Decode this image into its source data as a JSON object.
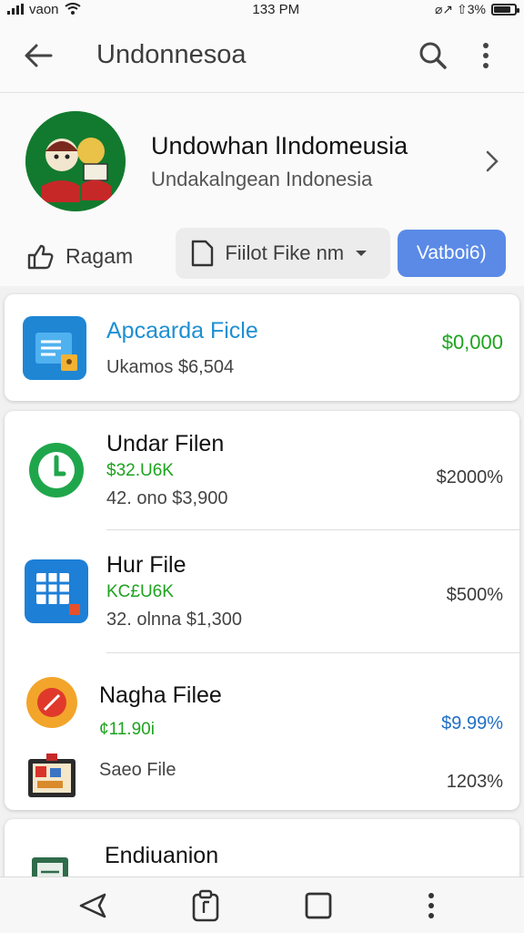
{
  "status": {
    "carrier": "vaon",
    "time": "133 PM",
    "battery_text": "⌀↗ ⇧3%",
    "battery_level": 0.8
  },
  "header": {
    "title": "Undonnesoa"
  },
  "profile": {
    "name": "Undowhan lIndomeusia",
    "subtitle": "Undakalngean Indonesia",
    "avatar_colors": {
      "bg": "#127a2e",
      "ring": "#c62828"
    }
  },
  "actions": {
    "ragam_label": "Ragam",
    "file_select_label": "Fiilot Fike nm",
    "primary_label": "Vatboi6)"
  },
  "featured": {
    "title": "Apcaarda Ficle",
    "subtitle": "Ukamos  $6,504",
    "price": "$0,000",
    "accent": "#1f8fd3",
    "price_color": "#1ea31e"
  },
  "list": {
    "items": [
      {
        "title": "Undar Filen",
        "green": "$32.U6K",
        "sub": "42. ono  $3,900",
        "price": "$2000%",
        "icon": "clock-icon",
        "color": "#1fa64b"
      },
      {
        "title": "Hur File",
        "green": "KC£U6K",
        "sub": "32. olnna  $1,300",
        "price": "$500%",
        "icon": "grid-icon",
        "color": "#1e7fd6"
      },
      {
        "title": "Nagha Filee",
        "green": "¢11.90i",
        "sub": "Saeo File",
        "price_top": "$9.99%",
        "price_bottom": "1203%",
        "icon": "record-icon",
        "color": "#f2a52a"
      }
    ]
  },
  "partial": {
    "title": "Endiuanion",
    "icon": "book-icon"
  },
  "bottom_nav": {
    "icons": [
      "back-icon",
      "clipboard-icon",
      "square-icon",
      "more-icon"
    ]
  }
}
